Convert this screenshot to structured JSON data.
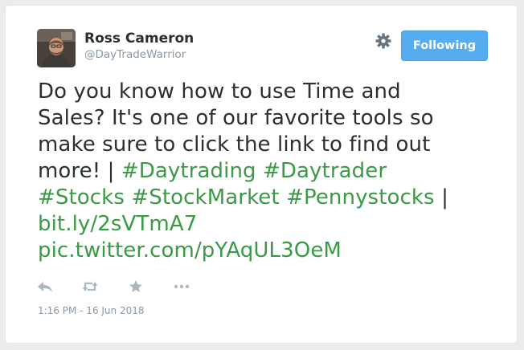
{
  "author": {
    "name": "Ross Cameron",
    "handle": "@DayTradeWarrior"
  },
  "follow_button": {
    "label": "Following"
  },
  "tweet": {
    "line1": "Do you know how to use Time and",
    "line2": "Sales? It's one of our favorite tools so",
    "line3": "make sure to click the link to find out",
    "line4_text": "more! | ",
    "hashtag1": "#Daytrading",
    "hashtag2": "#Daytrader",
    "hashtag3": "#Stocks",
    "hashtag4": "#StockMarket",
    "hashtag5": "#Pennystocks",
    "separator": " |",
    "link1": "bit.ly/2sVTmA7",
    "link2": "pic.twitter.com/pYAqUL3OeM"
  },
  "actions": {
    "icons": [
      "reply-icon",
      "retweet-icon",
      "favorite-icon",
      "more-icon"
    ]
  },
  "timestamp": "1:16 PM - 16 Jun 2018",
  "colors": {
    "link": "#3a9a45",
    "button": "#55acee",
    "text": "#292f33",
    "muted": "#8899a6"
  }
}
